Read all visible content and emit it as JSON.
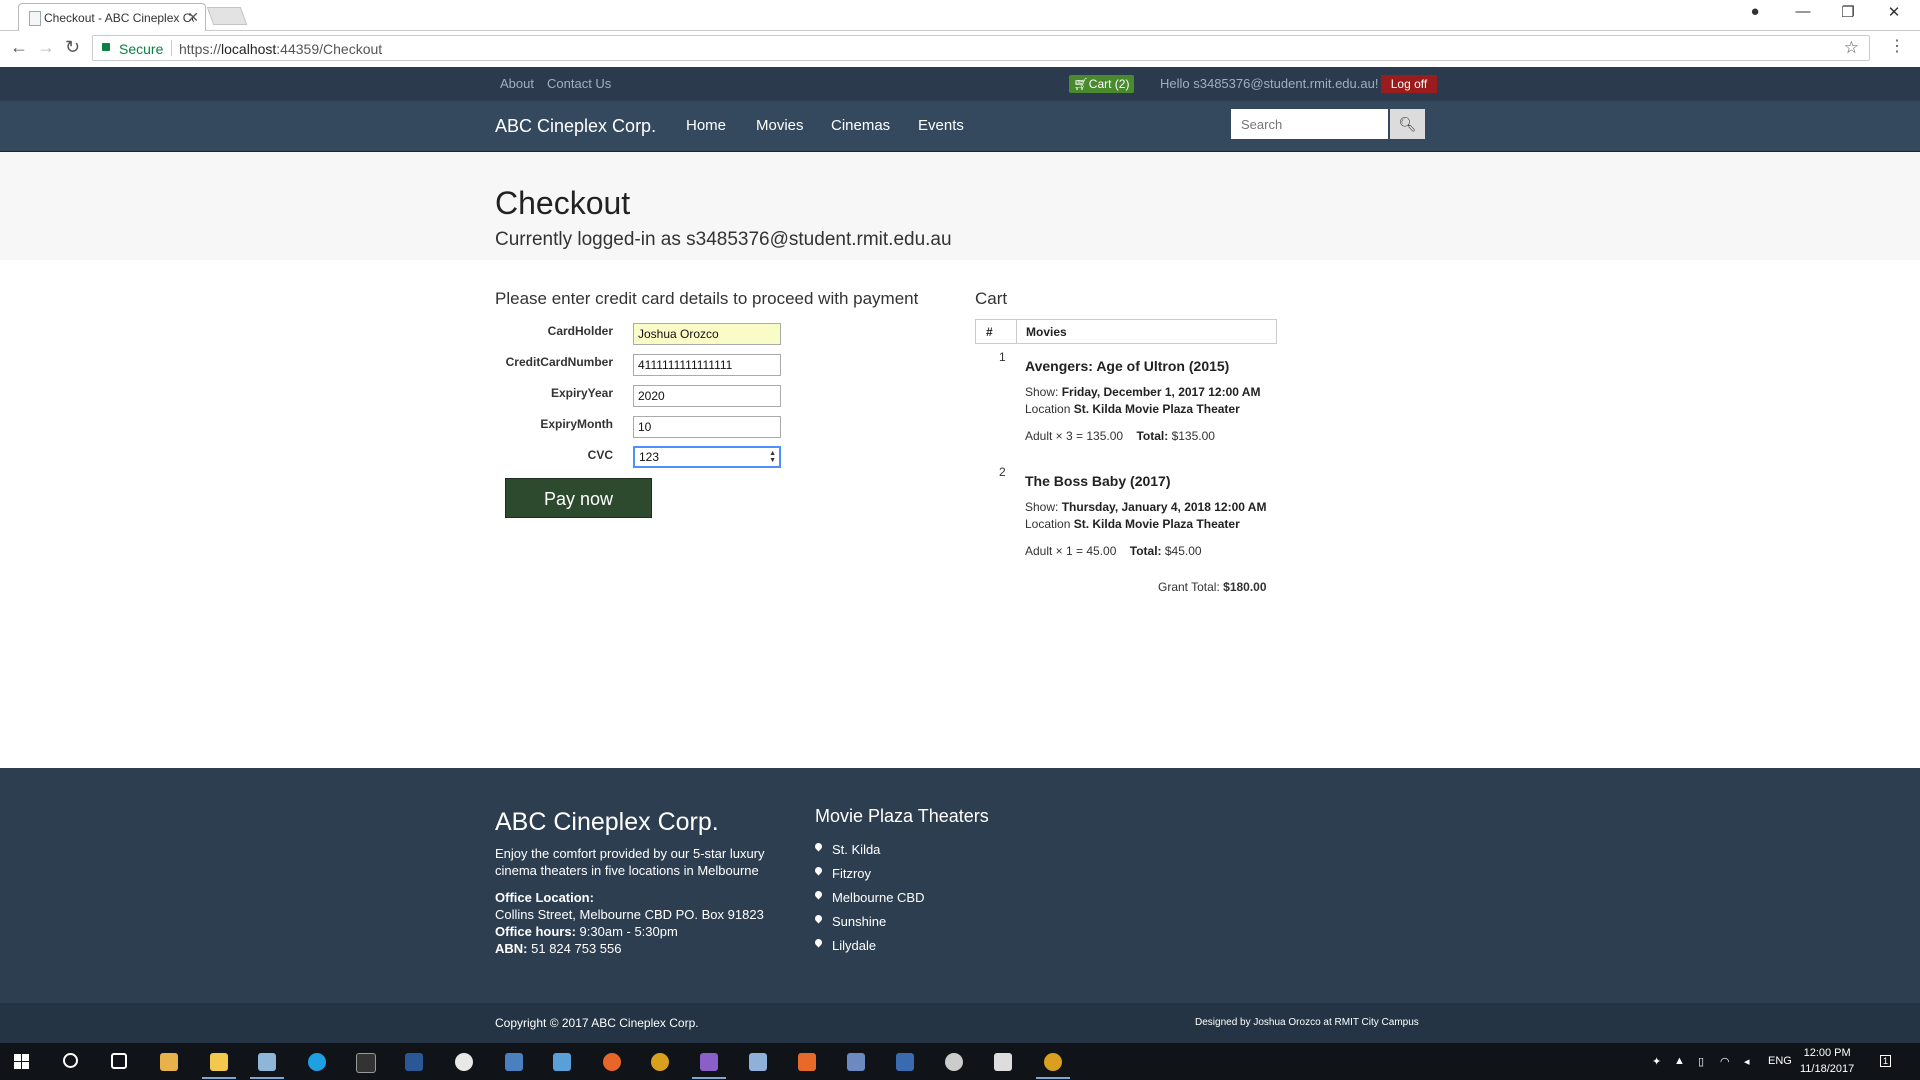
{
  "browser": {
    "tab_title": "Checkout - ABC Cineplex Corp.",
    "secure_label": "Secure",
    "url_scheme": "https://",
    "url_host": "localhost",
    "url_rest": ":44359/Checkout"
  },
  "topbar": {
    "about": "About",
    "contact": "Contact Us",
    "cart": "Cart (2)",
    "hello": "Hello s3485376@student.rmit.edu.au!",
    "logoff": "Log off"
  },
  "nav": {
    "brand": "ABC Cineplex Corp.",
    "links": [
      "Home",
      "Movies",
      "Cinemas",
      "Events"
    ],
    "search_placeholder": "Search"
  },
  "jumbotron": {
    "title": "Checkout",
    "subtitle": "Currently logged-in as s3485376@student.rmit.edu.au"
  },
  "payment": {
    "heading": "Please enter credit card details to proceed with payment",
    "fields": [
      {
        "label": "CardHolder",
        "value": "Joshua Orozco"
      },
      {
        "label": "CreditCardNumber",
        "value": "4111111111111111"
      },
      {
        "label": "ExpiryYear",
        "value": "2020"
      },
      {
        "label": "ExpiryMonth",
        "value": "10"
      },
      {
        "label": "CVC",
        "value": "123"
      }
    ],
    "pay_button": "Pay now"
  },
  "cart": {
    "heading": "Cart",
    "col_num": "#",
    "col_movies": "Movies",
    "items": [
      {
        "num": "1",
        "title": "Avengers: Age of Ultron (2015)",
        "show_label": "Show:",
        "show": "Friday, December 1, 2017 12:00 AM",
        "location_label": "Location",
        "location": "St. Kilda Movie Plaza Theater",
        "qty": "Adult × 3 = 135.00",
        "total_label": "Total:",
        "total": "$135.00"
      },
      {
        "num": "2",
        "title": "The Boss Baby (2017)",
        "show_label": "Show:",
        "show": "Thursday, January 4, 2018 12:00 AM",
        "location_label": "Location",
        "location": "St. Kilda Movie Plaza Theater",
        "qty": "Adult × 1 = 45.00",
        "total_label": "Total:",
        "total": "$45.00"
      }
    ],
    "grand_label": "Grant Total:",
    "grand_total": "$180.00"
  },
  "footer": {
    "brand": "ABC Cineplex Corp.",
    "tagline1": "Enjoy the comfort provided by our 5-star luxury",
    "tagline2": "cinema theaters in five locations in Melbourne",
    "office_label": "Office Location:",
    "office": "Collins Street, Melbourne CBD PO. Box 91823",
    "hours_label": "Office hours:",
    "hours": "9:30am - 5:30pm",
    "abn_label": "ABN:",
    "abn": "51 824 753 556",
    "theaters_heading": "Movie Plaza Theaters",
    "theaters": [
      "St. Kilda",
      "Fitzroy",
      "Melbourne CBD",
      "Sunshine",
      "Lilydale"
    ],
    "copyright": "Copyright © 2017 ABC Cineplex Corp.",
    "designed": "Designed by Joshua Orozco at RMIT City Campus"
  },
  "taskbar": {
    "lang": "ENG",
    "time": "12:00 PM",
    "date": "11/18/2017",
    "notification_count": "1"
  }
}
